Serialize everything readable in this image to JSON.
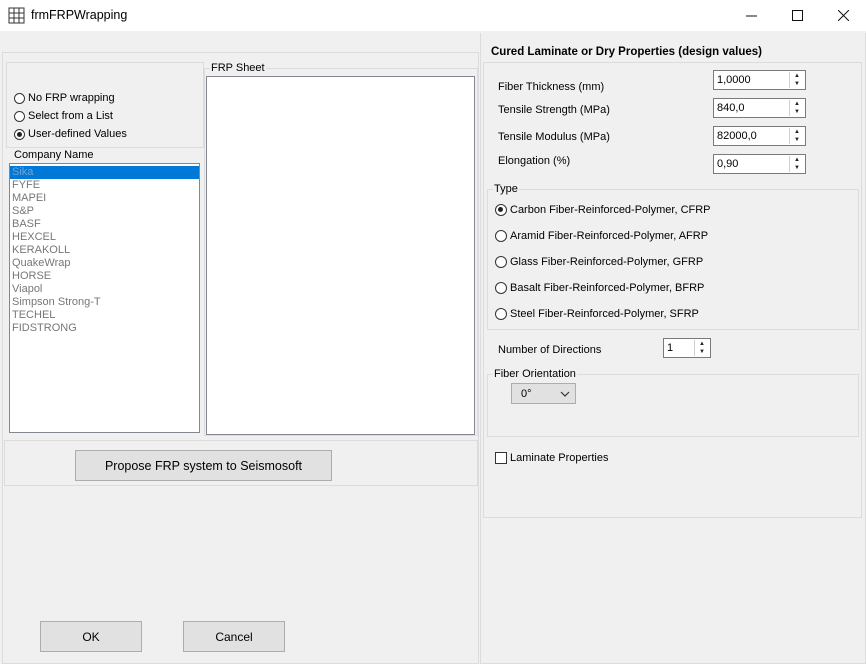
{
  "window": {
    "title": "frmFRPWrapping"
  },
  "source_group": {
    "options": [
      {
        "label": "No FRP wrapping",
        "checked": false
      },
      {
        "label": "Select from a List",
        "checked": false
      },
      {
        "label": "User-defined Values",
        "checked": true
      }
    ]
  },
  "company": {
    "label": "Company Name",
    "items": [
      "Sika",
      "FYFE",
      "MAPEI",
      "S&P",
      "BASF",
      "HEXCEL",
      "KERAKOLL",
      "QuakeWrap",
      "HORSE",
      "Viapol",
      "Simpson Strong-T",
      "TECHEL",
      "FIDSTRONG"
    ],
    "selected_index": 0
  },
  "frp_sheet": {
    "label": "FRP Sheet"
  },
  "propose_button": "Propose FRP system to Seismosoft",
  "properties": {
    "heading": "Cured Laminate or Dry Properties (design values)",
    "fields": [
      {
        "label": "Fiber Thickness (mm)",
        "value": "1,0000"
      },
      {
        "label": "Tensile Strength (MPa)",
        "value": "840,0"
      },
      {
        "label": "Tensile Modulus (MPa)",
        "value": "82000,0"
      },
      {
        "label": "Elongation (%)",
        "value": "0,90"
      }
    ]
  },
  "type_group": {
    "label": "Type",
    "options": [
      {
        "label": "Carbon Fiber-Reinforced-Polymer, CFRP",
        "checked": true
      },
      {
        "label": "Aramid Fiber-Reinforced-Polymer, AFRP",
        "checked": false
      },
      {
        "label": "Glass Fiber-Reinforced-Polymer, GFRP",
        "checked": false
      },
      {
        "label": "Basalt Fiber-Reinforced-Polymer, BFRP",
        "checked": false
      },
      {
        "label": "Steel Fiber-Reinforced-Polymer, SFRP",
        "checked": false
      }
    ]
  },
  "directions": {
    "label": "Number of Directions",
    "value": "1"
  },
  "orientation": {
    "label": "Fiber Orientation",
    "value": "0°"
  },
  "laminate": {
    "label": "Laminate Properties",
    "checked": false
  },
  "buttons": {
    "ok": "OK",
    "cancel": "Cancel"
  }
}
